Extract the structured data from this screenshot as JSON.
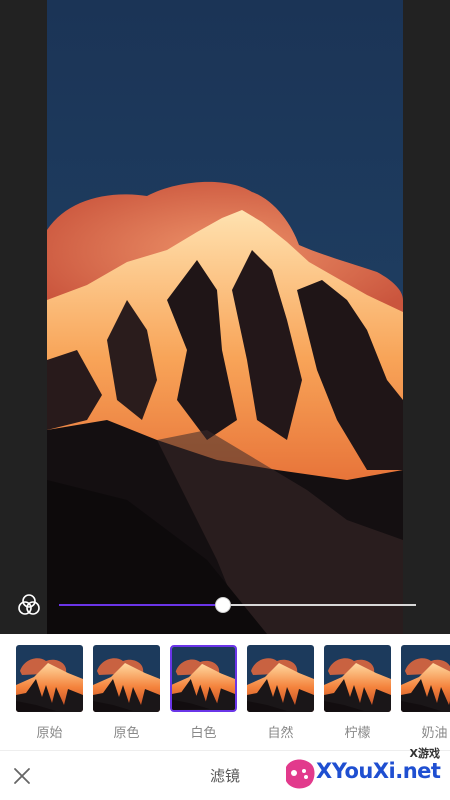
{
  "filter_panel": {
    "filters": [
      {
        "label": "原始",
        "selected": false
      },
      {
        "label": "原色",
        "selected": false
      },
      {
        "label": "白色",
        "selected": true
      },
      {
        "label": "自然",
        "selected": false
      },
      {
        "label": "柠檬",
        "selected": false
      },
      {
        "label": "奶油",
        "selected": false
      }
    ]
  },
  "intensity": {
    "value_fraction": 0.46
  },
  "bottom_bar": {
    "title": "滤镜"
  },
  "watermark": {
    "small_text": "X游戏",
    "main_text": "XYouXi.net"
  },
  "colors": {
    "accent": "#6a35e8",
    "sky": "#1c3a5c",
    "mountain_glow": "#f4823c"
  }
}
